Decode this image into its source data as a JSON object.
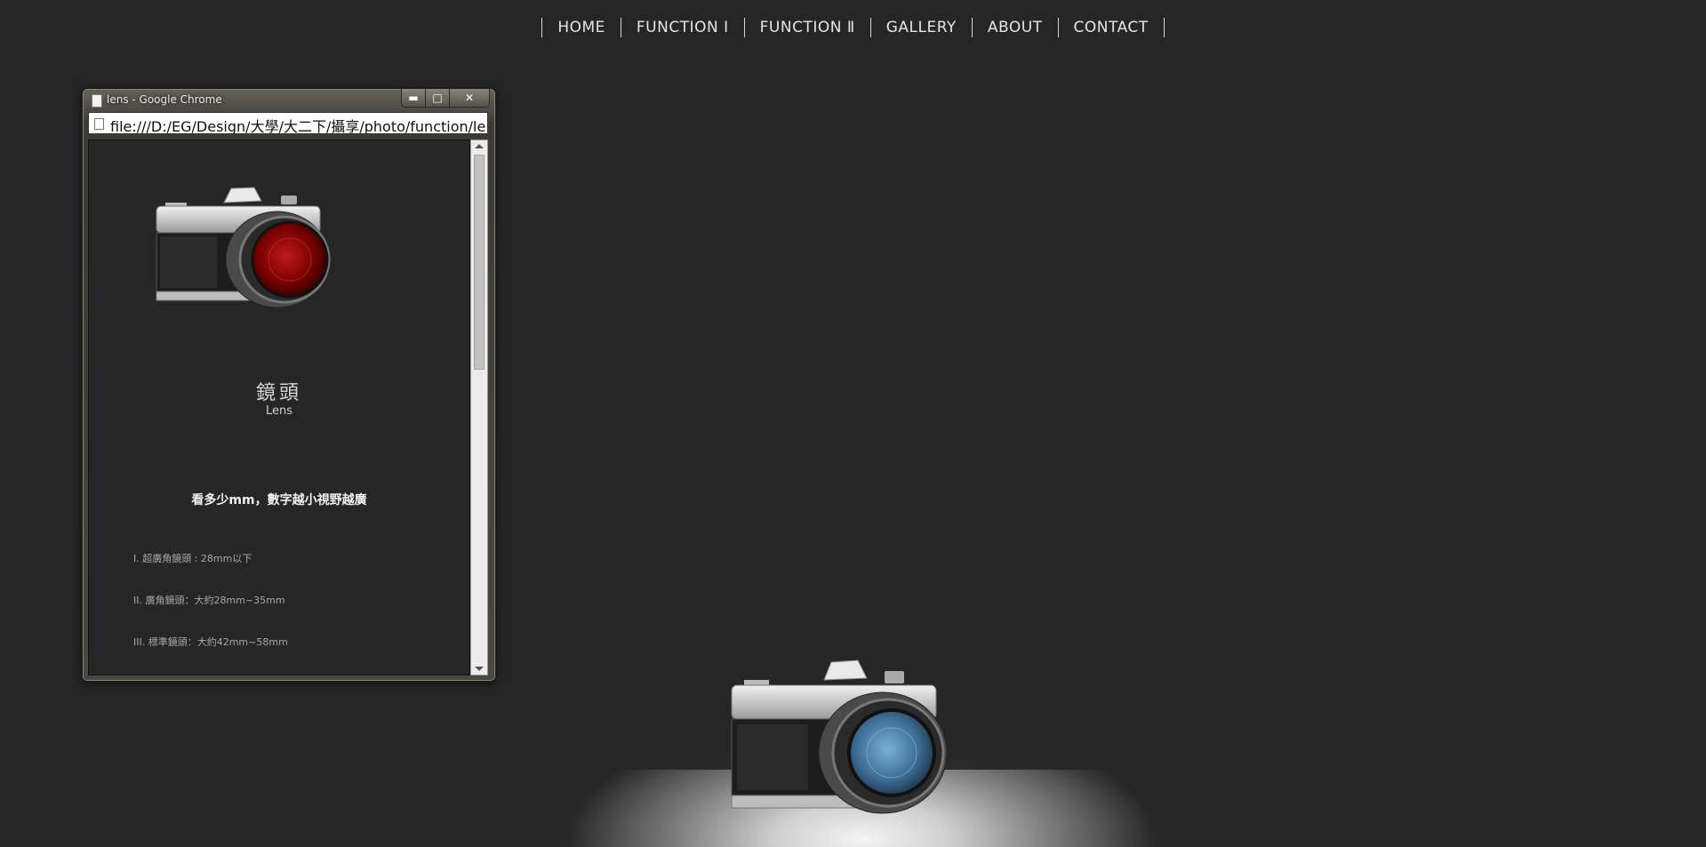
{
  "nav": {
    "items": [
      "HOME",
      "FUNCTION Ⅰ",
      "FUNCTION Ⅱ",
      "GALLERY",
      "ABOUT",
      "CONTACT"
    ]
  },
  "popup": {
    "window_title": "lens - Google Chrome",
    "address": "file:///D:/EG/Design/大學/大二下/攝享/photo/function/le",
    "controls": {
      "minimize": "▬",
      "maximize": "□",
      "close": "✕"
    },
    "heading_zh": "鏡頭",
    "heading_en": "Lens",
    "description": "看多少mm，數字越小視野越廣",
    "list": [
      "I. 超廣角鏡頭 : 28mm以下",
      "II. 廣角鏡頭：大約28mm~35mm",
      "III. 標準鏡頭：大約42mm~58mm"
    ]
  },
  "colors": {
    "background": "#262626",
    "lens_red": "#8b0000",
    "lens_blue": "#4a7ea6"
  },
  "icons": [
    "page-icon",
    "file-icon",
    "minimize-icon",
    "maximize-icon",
    "close-icon",
    "scroll-up-icon",
    "scroll-down-icon"
  ]
}
